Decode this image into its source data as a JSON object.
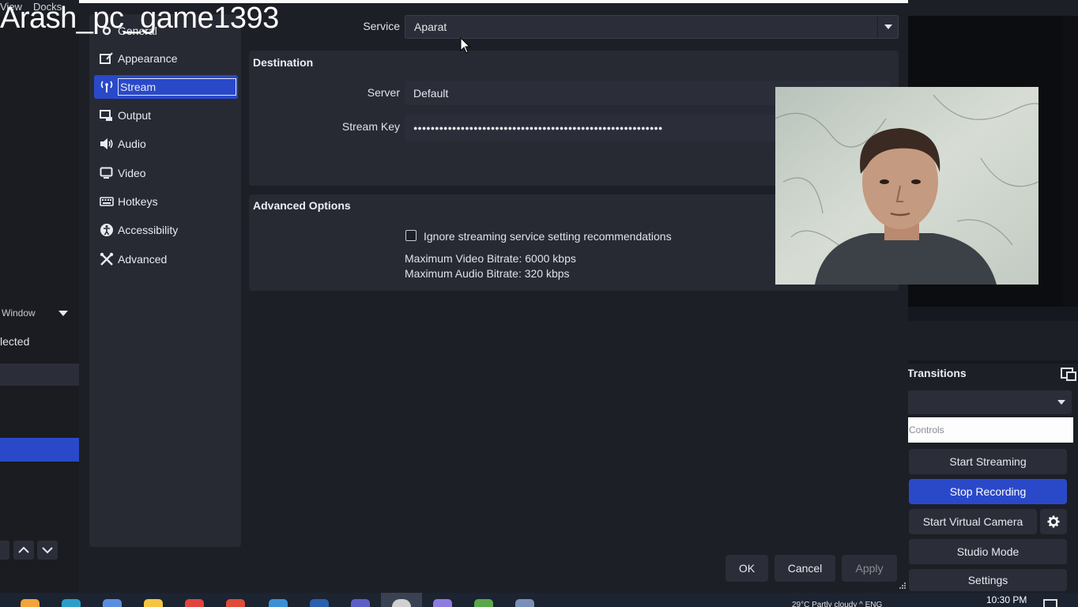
{
  "watermark": "Arash_pc_game1393",
  "background": {
    "menu": [
      "View",
      "Docks"
    ],
    "window_label": "Window",
    "lected_text": "lected"
  },
  "sidebar": {
    "items": [
      {
        "label": "General",
        "icon": "gear-icon"
      },
      {
        "label": "Appearance",
        "icon": "palette-icon"
      },
      {
        "label": "Stream",
        "icon": "antenna-icon"
      },
      {
        "label": "Output",
        "icon": "output-icon"
      },
      {
        "label": "Audio",
        "icon": "speaker-icon"
      },
      {
        "label": "Video",
        "icon": "monitor-icon"
      },
      {
        "label": "Hotkeys",
        "icon": "keyboard-icon"
      },
      {
        "label": "Accessibility",
        "icon": "accessibility-icon"
      },
      {
        "label": "Advanced",
        "icon": "wrench-icon"
      }
    ],
    "active": "Stream"
  },
  "stream": {
    "service_label": "Service",
    "service_value": "Aparat",
    "destination_title": "Destination",
    "server_label": "Server",
    "server_value": "Default",
    "stream_key_label": "Stream Key",
    "stream_key_value": "●●●●●●●●●●●●●●●●●●●●●●●●●●●●●●●●●●●●●●●●●●●●●●●●●●●●●●●●●●",
    "advanced_title": "Advanced Options",
    "ignore_checkbox_label": "Ignore streaming service setting recommendations",
    "ignore_checked": false,
    "max_video_bitrate": "Maximum Video Bitrate: 6000 kbps",
    "max_audio_bitrate": "Maximum Audio Bitrate: 320 kbps"
  },
  "dialog_buttons": {
    "ok": "OK",
    "cancel": "Cancel",
    "apply": "Apply"
  },
  "dock": {
    "transitions_title": "Transitions",
    "controls_label": "Controls",
    "start_streaming": "Start Streaming",
    "stop_recording": "Stop Recording",
    "start_virtual_camera": "Start Virtual Camera",
    "studio_mode": "Studio Mode",
    "settings": "Settings"
  },
  "taskbar": {
    "clock": "10:30 PM",
    "tray_text": "29°C  Partly cloudy  ^  ENG"
  },
  "colors": {
    "accent": "#2a49c9",
    "dialog_bg": "#1d1f26",
    "panel_bg": "#272a33",
    "field_bg": "#2b2e38"
  }
}
